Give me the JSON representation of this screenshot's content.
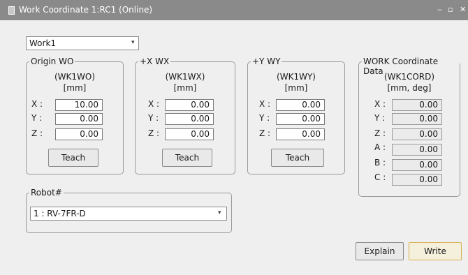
{
  "window": {
    "title": "Work Coordinate 1:RC1 (Online)",
    "minimize": "‒",
    "maximize": "▫",
    "close": "✕"
  },
  "work_select": {
    "value": "Work1",
    "arrow": "▾"
  },
  "origin": {
    "title": "Origin WO",
    "name": "(WK1WO)",
    "unit": "[mm]",
    "rows": [
      {
        "label": "X :",
        "value": "10.00"
      },
      {
        "label": "Y :",
        "value": "0.00"
      },
      {
        "label": "Z :",
        "value": "0.00"
      }
    ],
    "teach": "Teach"
  },
  "xwx": {
    "title": "+X WX",
    "name": "(WK1WX)",
    "unit": "[mm]",
    "rows": [
      {
        "label": "X :",
        "value": "0.00"
      },
      {
        "label": "Y :",
        "value": "0.00"
      },
      {
        "label": "Z :",
        "value": "0.00"
      }
    ],
    "teach": "Teach"
  },
  "ywy": {
    "title": "+Y WY",
    "name": "(WK1WY)",
    "unit": "[mm]",
    "rows": [
      {
        "label": "X :",
        "value": "0.00"
      },
      {
        "label": "Y :",
        "value": "0.00"
      },
      {
        "label": "Z :",
        "value": "0.00"
      }
    ],
    "teach": "Teach"
  },
  "coord": {
    "title": "WORK Coordinate Data",
    "name": "(WK1CORD)",
    "unit": "[mm, deg]",
    "rows": [
      {
        "label": "X :",
        "value": "0.00"
      },
      {
        "label": "Y :",
        "value": "0.00"
      },
      {
        "label": "Z :",
        "value": "0.00"
      },
      {
        "label": "A :",
        "value": "0.00"
      },
      {
        "label": "B :",
        "value": "0.00"
      },
      {
        "label": "C :",
        "value": "0.00"
      }
    ]
  },
  "robot": {
    "title": "Robot#",
    "value": "1 : RV-7FR-D",
    "arrow": "▾"
  },
  "buttons": {
    "explain": "Explain",
    "write": "Write"
  }
}
